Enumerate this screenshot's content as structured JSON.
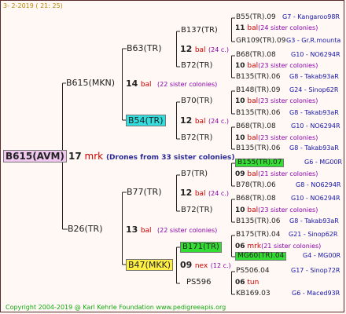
{
  "header": {
    "date": "3-  2-2019  ( 21: 25)"
  },
  "footer": {
    "text": "Copyright 2004-2019 @ Karl Kehrle Foundation    www.pedigreeapis.org"
  },
  "root": {
    "name": "B615(AVM)",
    "count": "17",
    "type": "mrk",
    "note": "(Drones from 33 sister colonies)"
  },
  "l1": [
    {
      "name": "B615(MKN)",
      "count": "14",
      "type": "bal",
      "note": "(22 sister colonies)"
    },
    {
      "name": "B26(TR)",
      "count": "13",
      "type": "bal",
      "note": "(22 sister colonies)"
    }
  ],
  "l2": [
    {
      "name": "B63(TR)",
      "count": "12",
      "type": "bal",
      "note": "(24 c.)"
    },
    {
      "name": "B54(TR)",
      "count": "12",
      "type": "bal",
      "note": "(24 c.)"
    },
    {
      "name": "B77(TR)",
      "count": "12",
      "type": "bal",
      "note": "(24 c.)"
    },
    {
      "name": "B47(MKK)",
      "count": "09",
      "type": "nex",
      "note": "(12 c.)"
    }
  ],
  "l3": [
    {
      "name": "B137(TR)",
      "count": "11",
      "type": "bal",
      "note": "(24 sister colonies)"
    },
    {
      "name": "B72(TR)",
      "count": "10",
      "type": "bal",
      "note": "(23 sister colonies)"
    },
    {
      "name": "B70(TR)",
      "count": "10",
      "type": "bal",
      "note": "(23 sister colonies)"
    },
    {
      "name": "B72(TR)",
      "count": "10",
      "type": "bal",
      "note": "(23 sister colonies)"
    },
    {
      "name": "B7(TR)",
      "count": "09",
      "type": "bal",
      "note": "(21 sister colonies)"
    },
    {
      "name": "B72(TR)",
      "count": "10",
      "type": "bal",
      "note": "(23 sister colonies)"
    },
    {
      "name": "B171(TR)",
      "count": "06",
      "type": "mrk",
      "note": "(21 sister colonies)"
    },
    {
      "name": "PS596",
      "count": "06",
      "type": "tun",
      "note": ""
    }
  ],
  "l4": [
    {
      "name": "B55(TR).09",
      "info": "G7 - Kangaroo98R"
    },
    {
      "name": "GR109(TR).09",
      "info": "G3 - Gr.R.mounta"
    },
    {
      "name": "B68(TR).08",
      "info": "G10 - NO6294R"
    },
    {
      "name": "B135(TR).06",
      "info": "G8 - Takab93aR"
    },
    {
      "name": "B148(TR).09",
      "info": "G24 - Sinop62R"
    },
    {
      "name": "B135(TR).06",
      "info": "G8 - Takab93aR"
    },
    {
      "name": "B68(TR).08",
      "info": "G10 - NO6294R"
    },
    {
      "name": "B135(TR).06",
      "info": "G8 - Takab93aR"
    },
    {
      "name": "B155(TR).07",
      "info": "G6 - MG00R"
    },
    {
      "name": "B78(TR).06",
      "info": "G8 - NO6294R"
    },
    {
      "name": "B68(TR).08",
      "info": "G10 - NO6294R"
    },
    {
      "name": "B135(TR).06",
      "info": "G8 - Takab93aR"
    },
    {
      "name": "B175(TR).04",
      "info": "G21 - Sinop62R"
    },
    {
      "name": "MG60(TR).04",
      "info": "G4 - MG00R"
    },
    {
      "name": "PS506.04",
      "info": "G17 - Sinop72R"
    },
    {
      "name": "KB169.03",
      "info": "G6 - Maced93R"
    }
  ]
}
